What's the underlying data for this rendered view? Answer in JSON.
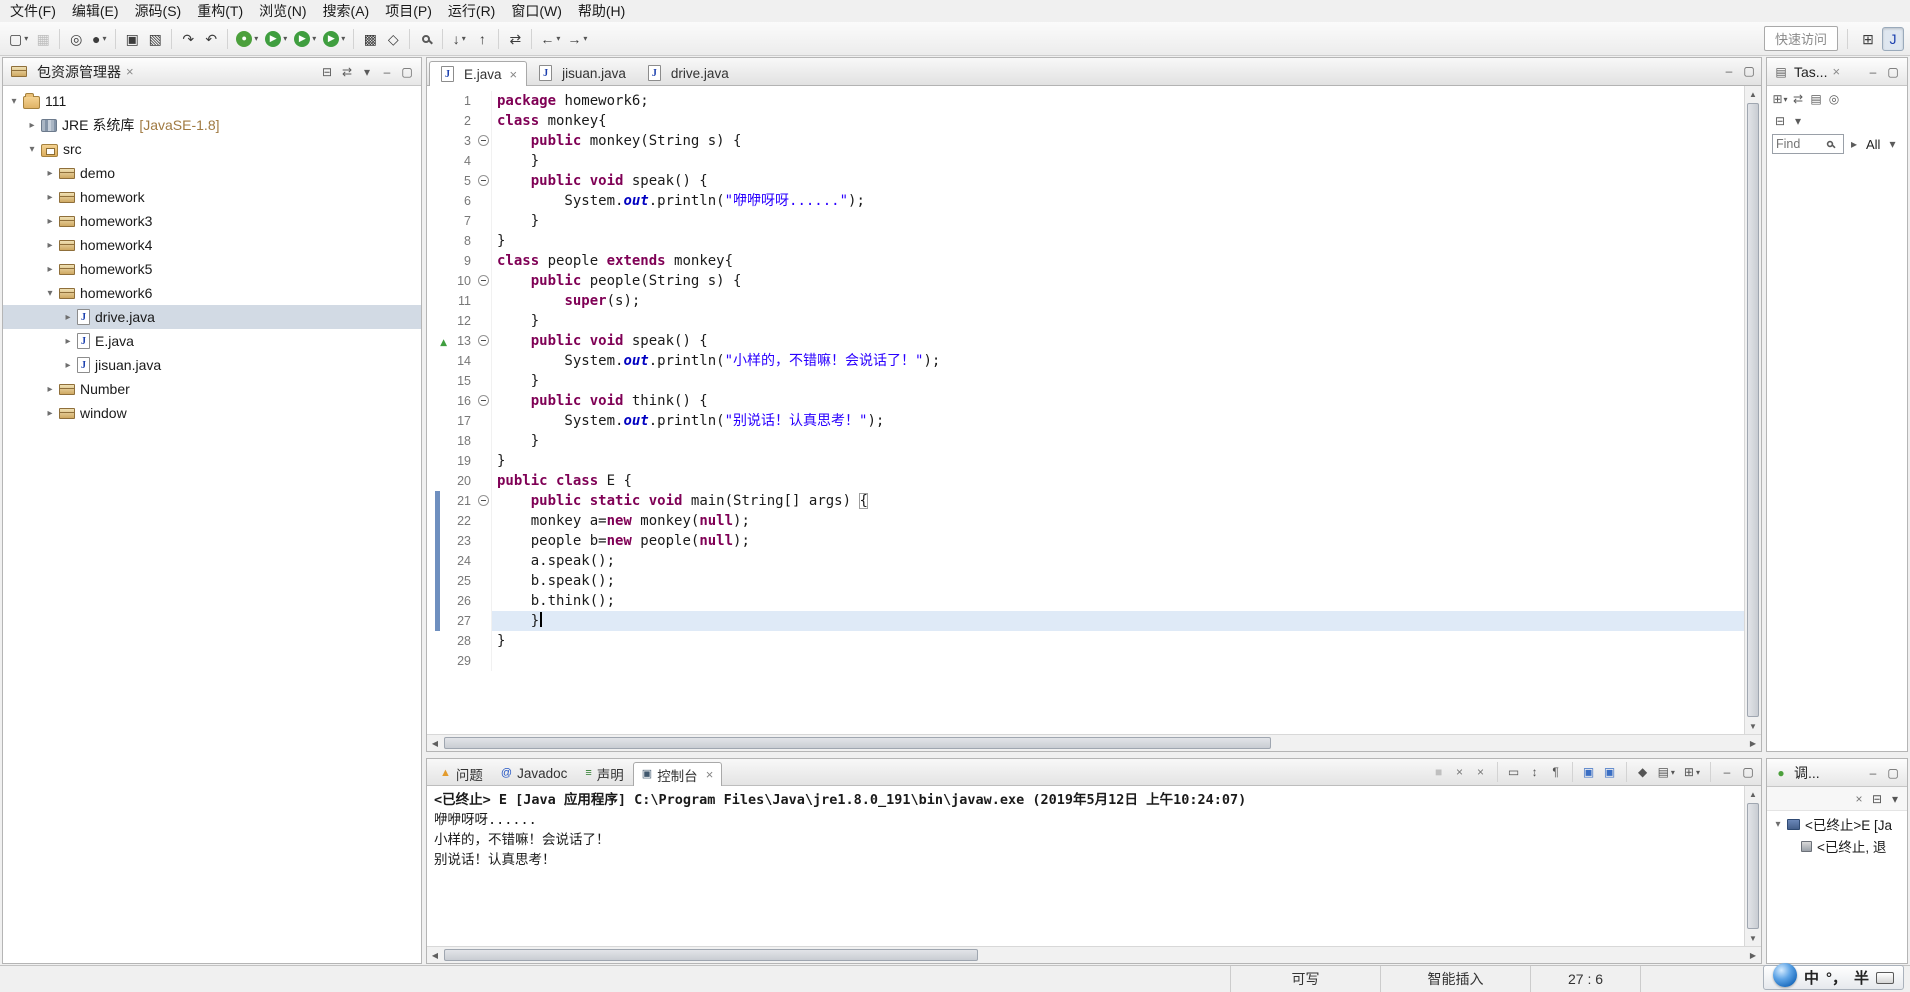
{
  "colors": {
    "kw": "#7f0055",
    "str": "#2a00ff",
    "fld": "#0000c0",
    "diff": "#6f8fbf",
    "override": "#3f9e3f",
    "currentline": "#dfeaf7",
    "selection": "#d2dae4",
    "linenum": "#787878",
    "decoration": "#a07a42"
  },
  "menubar": {
    "items": [
      "文件(F)",
      "编辑(E)",
      "源码(S)",
      "重构(T)",
      "浏览(N)",
      "搜索(A)",
      "项目(P)",
      "运行(R)",
      "窗口(W)",
      "帮助(H)"
    ]
  },
  "toolbar": {
    "quick_access": "快速访问",
    "buttons": [
      {
        "name": "new-wizard",
        "glyph": "▢",
        "dd": true
      },
      {
        "name": "save",
        "glyph": "▦",
        "disabled": true
      },
      {
        "sep": true
      },
      {
        "name": "skip-all-breakpoints",
        "glyph": "◎"
      },
      {
        "name": "external-tools",
        "glyph": "●",
        "dd": true
      },
      {
        "sep": true
      },
      {
        "name": "open-console",
        "glyph": "▣"
      },
      {
        "name": "new-visual-class",
        "glyph": "▧"
      },
      {
        "sep": true
      },
      {
        "name": "next-annotation",
        "glyph": "↷"
      },
      {
        "name": "previous-annotation",
        "glyph": "↶"
      },
      {
        "sep": true
      },
      {
        "name": "debug",
        "glyph": "●",
        "circle": "#4ca03c",
        "dd": true
      },
      {
        "name": "run",
        "glyph": "▶",
        "circle": "#3f9e3f",
        "dd": true
      },
      {
        "name": "coverage",
        "glyph": "▶",
        "circle": "#3f9e3f",
        "dd": true
      },
      {
        "name": "run-external",
        "glyph": "▶",
        "circle": "#3f9e3f",
        "dd": true
      },
      {
        "sep": true
      },
      {
        "name": "new-java-project",
        "glyph": "▩"
      },
      {
        "name": "new-java-class",
        "glyph": "◇"
      },
      {
        "sep": true
      },
      {
        "name": "search",
        "mag": true
      },
      {
        "sep": true
      },
      {
        "name": "next-edit-location",
        "glyph": "↓",
        "dd": true
      },
      {
        "name": "last-edit-location",
        "glyph": "↑"
      },
      {
        "sep": true
      },
      {
        "name": "link-with-editor",
        "glyph": "⇄"
      },
      {
        "sep": true
      },
      {
        "name": "back",
        "glyph": "←",
        "dd": true
      },
      {
        "name": "forward",
        "glyph": "→",
        "dd": true
      }
    ],
    "right_buttons": [
      {
        "name": "open-perspective",
        "glyph": "⊞"
      },
      {
        "name": "java-perspective",
        "glyph": "J",
        "color": "#1b3fae",
        "pressed": true
      }
    ]
  },
  "package_explorer": {
    "title": "包资源管理器",
    "close": "×",
    "header_icons": [
      {
        "name": "collapse-all",
        "glyph": "⊟"
      },
      {
        "name": "link-with-editor",
        "glyph": "⇄"
      },
      {
        "name": "view-menu",
        "glyph": "▾"
      },
      {
        "name": "minimize",
        "glyph": "–"
      },
      {
        "name": "maximize",
        "glyph": "▢"
      }
    ],
    "tree": [
      {
        "label": "111",
        "icon": "project",
        "level": 0,
        "arrow": "expanded"
      },
      {
        "label": "JRE 系统库",
        "decoration": " [JavaSE-1.8]",
        "icon": "library",
        "level": 1,
        "arrow": "collapsed"
      },
      {
        "label": "src",
        "icon": "srcfolder",
        "level": 1,
        "arrow": "expanded"
      },
      {
        "label": "demo",
        "icon": "package",
        "level": 2,
        "arrow": "collapsed"
      },
      {
        "label": "homework",
        "icon": "package",
        "level": 2,
        "arrow": "collapsed"
      },
      {
        "label": "homework3",
        "icon": "package",
        "level": 2,
        "arrow": "collapsed"
      },
      {
        "label": "homework4",
        "icon": "package",
        "level": 2,
        "arrow": "collapsed"
      },
      {
        "label": "homework5",
        "icon": "package",
        "level": 2,
        "arrow": "collapsed"
      },
      {
        "label": "homework6",
        "icon": "package",
        "level": 2,
        "arrow": "expanded"
      },
      {
        "label": "drive.java",
        "icon": "jfile",
        "level": 3,
        "arrow": "collapsed",
        "selected": true
      },
      {
        "label": "E.java",
        "icon": "jfile",
        "level": 3,
        "arrow": "collapsed"
      },
      {
        "label": "jisuan.java",
        "icon": "jfile",
        "level": 3,
        "arrow": "collapsed"
      },
      {
        "label": "Number",
        "icon": "package",
        "level": 2,
        "arrow": "collapsed"
      },
      {
        "label": "window",
        "icon": "package",
        "level": 2,
        "arrow": "collapsed"
      }
    ]
  },
  "editor": {
    "tabs": [
      {
        "label": "E.java",
        "active": true,
        "close": "×"
      },
      {
        "label": "jisuan.java"
      },
      {
        "label": "drive.java"
      }
    ],
    "window_icons": [
      {
        "name": "minimize",
        "glyph": "–"
      },
      {
        "name": "maximize",
        "glyph": "▢"
      }
    ],
    "fold_lines": [
      3,
      5,
      10,
      13,
      16,
      21
    ],
    "override_lines": [
      13
    ],
    "diff_lines": [
      21,
      22,
      23,
      24,
      25,
      26,
      27
    ],
    "current_line": 27,
    "lines": [
      {
        "n": 1,
        "t": [
          [
            "k",
            "package"
          ],
          [
            "p",
            " homework6;"
          ]
        ]
      },
      {
        "n": 2,
        "t": [
          [
            "k",
            "class"
          ],
          [
            "p",
            " monkey{"
          ]
        ]
      },
      {
        "n": 3,
        "t": [
          [
            "p",
            "    "
          ],
          [
            "k",
            "public"
          ],
          [
            "p",
            " monkey(String s) {"
          ]
        ]
      },
      {
        "n": 4,
        "t": [
          [
            "p",
            "    }"
          ]
        ]
      },
      {
        "n": 5,
        "t": [
          [
            "p",
            "    "
          ],
          [
            "k",
            "public"
          ],
          [
            "p",
            " "
          ],
          [
            "k",
            "void"
          ],
          [
            "p",
            " speak() {"
          ]
        ]
      },
      {
        "n": 6,
        "t": [
          [
            "p",
            "        System."
          ],
          [
            "f",
            "out"
          ],
          [
            "p",
            ".println("
          ],
          [
            "s",
            "\"咿咿呀呀......\""
          ],
          [
            "p",
            ");"
          ]
        ]
      },
      {
        "n": 7,
        "t": [
          [
            "p",
            "    }"
          ]
        ]
      },
      {
        "n": 8,
        "t": [
          [
            "p",
            "}"
          ]
        ]
      },
      {
        "n": 9,
        "t": [
          [
            "k",
            "class"
          ],
          [
            "p",
            " people "
          ],
          [
            "k",
            "extends"
          ],
          [
            "p",
            " monkey{"
          ]
        ]
      },
      {
        "n": 10,
        "t": [
          [
            "p",
            "    "
          ],
          [
            "k",
            "public"
          ],
          [
            "p",
            " people(String s) {"
          ]
        ]
      },
      {
        "n": 11,
        "t": [
          [
            "p",
            "        "
          ],
          [
            "k",
            "super"
          ],
          [
            "p",
            "(s);"
          ]
        ]
      },
      {
        "n": 12,
        "t": [
          [
            "p",
            "    }"
          ]
        ]
      },
      {
        "n": 13,
        "t": [
          [
            "p",
            "    "
          ],
          [
            "k",
            "public"
          ],
          [
            "p",
            " "
          ],
          [
            "k",
            "void"
          ],
          [
            "p",
            " speak() {"
          ]
        ]
      },
      {
        "n": 14,
        "t": [
          [
            "p",
            "        System."
          ],
          [
            "f",
            "out"
          ],
          [
            "p",
            ".println("
          ],
          [
            "s",
            "\"小样的，不错嘛！会说话了！\""
          ],
          [
            "p",
            ");"
          ]
        ]
      },
      {
        "n": 15,
        "t": [
          [
            "p",
            "    }"
          ]
        ]
      },
      {
        "n": 16,
        "t": [
          [
            "p",
            "    "
          ],
          [
            "k",
            "public"
          ],
          [
            "p",
            " "
          ],
          [
            "k",
            "void"
          ],
          [
            "p",
            " think() {"
          ]
        ]
      },
      {
        "n": 17,
        "t": [
          [
            "p",
            "        System."
          ],
          [
            "f",
            "out"
          ],
          [
            "p",
            ".println("
          ],
          [
            "s",
            "\"别说话！认真思考！\""
          ],
          [
            "p",
            ");"
          ]
        ]
      },
      {
        "n": 18,
        "t": [
          [
            "p",
            "    }"
          ]
        ]
      },
      {
        "n": 19,
        "t": [
          [
            "p",
            "}"
          ]
        ]
      },
      {
        "n": 20,
        "t": [
          [
            "k",
            "public"
          ],
          [
            "p",
            " "
          ],
          [
            "k",
            "class"
          ],
          [
            "p",
            " E {"
          ]
        ]
      },
      {
        "n": 21,
        "t": [
          [
            "p",
            "    "
          ],
          [
            "k",
            "public"
          ],
          [
            "p",
            " "
          ],
          [
            "k",
            "static"
          ],
          [
            "p",
            " "
          ],
          [
            "k",
            "void"
          ],
          [
            "p",
            " main(String[] args) "
          ],
          [
            "b",
            "{"
          ]
        ]
      },
      {
        "n": 22,
        "t": [
          [
            "p",
            "    monkey a="
          ],
          [
            "k",
            "new"
          ],
          [
            "p",
            " monkey("
          ],
          [
            "k",
            "null"
          ],
          [
            "p",
            ");"
          ]
        ]
      },
      {
        "n": 23,
        "t": [
          [
            "p",
            "    people b="
          ],
          [
            "k",
            "new"
          ],
          [
            "p",
            " people("
          ],
          [
            "k",
            "null"
          ],
          [
            "p",
            ");"
          ]
        ]
      },
      {
        "n": 24,
        "t": [
          [
            "p",
            "    a.speak();"
          ]
        ]
      },
      {
        "n": 25,
        "t": [
          [
            "p",
            "    b.speak();"
          ]
        ]
      },
      {
        "n": 26,
        "t": [
          [
            "p",
            "    b.think();"
          ]
        ]
      },
      {
        "n": 27,
        "t": [
          [
            "p",
            "    }"
          ]
        ]
      },
      {
        "n": 28,
        "t": [
          [
            "p",
            "}"
          ]
        ]
      },
      {
        "n": 29,
        "t": []
      }
    ]
  },
  "task_list": {
    "title": "Tas...",
    "close": "×",
    "window_icons": [
      {
        "name": "minimize",
        "glyph": "–"
      },
      {
        "name": "maximize",
        "glyph": "▢"
      }
    ],
    "icons_row1": [
      {
        "name": "new-task",
        "glyph": "⊞",
        "dd": true
      },
      {
        "name": "synchronize",
        "glyph": "⇄"
      },
      {
        "name": "group-by",
        "glyph": "▤"
      },
      {
        "name": "filter",
        "glyph": "◎"
      }
    ],
    "icons_row2": [
      {
        "name": "collapse-all",
        "glyph": "⊟"
      },
      {
        "name": "view-menu",
        "glyph": "▾"
      }
    ],
    "find_placeholder": "Find",
    "nav_prev": "▸",
    "scope": "All",
    "scope_dropdown": "▾"
  },
  "console": {
    "tabs": [
      {
        "label": "问题",
        "glyph": "▲",
        "color": "#e39b2d"
      },
      {
        "label": "Javadoc",
        "glyph": "@",
        "color": "#2456c4"
      },
      {
        "label": "声明",
        "glyph": "≡",
        "color": "#2d7d2d"
      },
      {
        "label": "控制台",
        "glyph": "▣",
        "color": "#40586e",
        "active": true,
        "close": "×"
      }
    ],
    "toolbar": [
      {
        "name": "terminate",
        "glyph": "■",
        "color": "#bfbfbf"
      },
      {
        "name": "remove-launch",
        "glyph": "×",
        "color": "#777777"
      },
      {
        "name": "remove-all-terminated",
        "glyph": "×",
        "color": "#777777"
      },
      {
        "sep": true
      },
      {
        "name": "clear-console",
        "glyph": "▭",
        "color": "#555555"
      },
      {
        "name": "scroll-lock",
        "glyph": "↕",
        "color": "#555555"
      },
      {
        "name": "word-wrap",
        "glyph": "¶",
        "color": "#555555"
      },
      {
        "sep": true
      },
      {
        "name": "show-stdout-changed",
        "glyph": "▣",
        "color": "#3b6fc4"
      },
      {
        "name": "show-stderr-changed",
        "glyph": "▣",
        "color": "#3b6fc4"
      },
      {
        "sep": true
      },
      {
        "name": "pin-console",
        "glyph": "◆",
        "color": "#555555"
      },
      {
        "name": "display-selected-console",
        "glyph": "▤",
        "color": "#555555",
        "dd": true
      },
      {
        "name": "open-console",
        "glyph": "⊞",
        "color": "#555555",
        "dd": true
      },
      {
        "sep": true
      },
      {
        "name": "minimize",
        "glyph": "–",
        "color": "#555555"
      },
      {
        "name": "maximize",
        "glyph": "▢",
        "color": "#555555"
      }
    ],
    "title_line": "<已终止> E [Java 应用程序] C:\\Program Files\\Java\\jre1.8.0_191\\bin\\javaw.exe (2019年5月12日 上午10:24:07)",
    "output": [
      "咿咿呀呀......",
      "小样的，不错嘛！会说话了！",
      "别说话！认真思考！"
    ]
  },
  "debug": {
    "title": "调...",
    "window_icons": [
      {
        "name": "minimize",
        "glyph": "–"
      },
      {
        "name": "maximize",
        "glyph": "▢"
      }
    ],
    "toolbar": [
      {
        "name": "remove-all-terminated",
        "glyph": "×",
        "color": "#777777"
      },
      {
        "name": "collapse-all",
        "glyph": "⊟",
        "color": "#555555"
      },
      {
        "name": "view-menu",
        "glyph": "▾",
        "color": "#555555"
      }
    ],
    "rows": [
      {
        "label": "<已终止>E [Ja",
        "icon": "launch",
        "arrow": true,
        "level": 0
      },
      {
        "label": "<已终止, 退",
        "icon": "process",
        "level": 1
      }
    ]
  },
  "statusbar": {
    "writable": "可写",
    "insert_mode": "智能插入",
    "position": "27 : 6"
  },
  "ime": {
    "lang": "中",
    "punct": "°，",
    "width": "半"
  }
}
